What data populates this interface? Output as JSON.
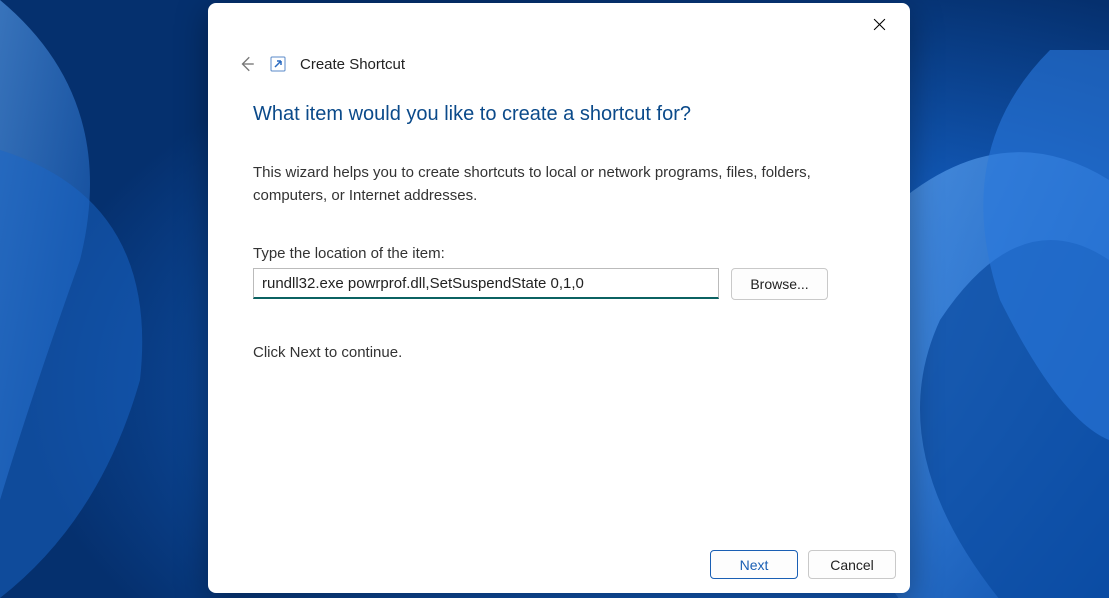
{
  "dialog": {
    "title": "Create Shortcut",
    "heading": "What item would you like to create a shortcut for?",
    "description": "This wizard helps you to create shortcuts to local or network programs, files, folders, computers, or Internet addresses.",
    "field_label": "Type the location of the item:",
    "location_value": "rundll32.exe powrprof.dll,SetSuspendState 0,1,0",
    "browse_label": "Browse...",
    "continue_text": "Click Next to continue.",
    "next_label": "Next",
    "cancel_label": "Cancel"
  }
}
